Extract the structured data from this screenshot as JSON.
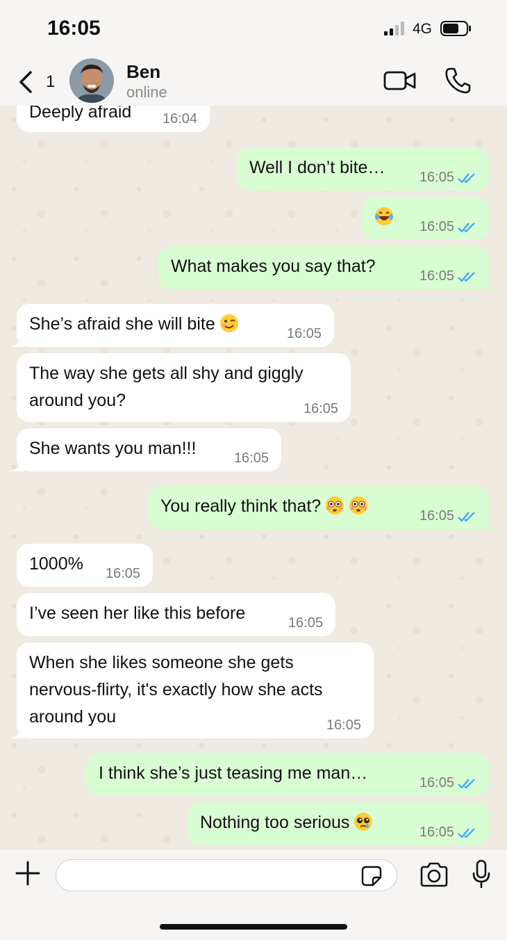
{
  "status_bar": {
    "time": "16:05",
    "network": "4G"
  },
  "header": {
    "back_count": "1",
    "contact_name": "Ben",
    "contact_status": "online"
  },
  "messages": [
    {
      "dir": "in",
      "text": "Deeply afraid",
      "time": "16:04"
    },
    {
      "dir": "out",
      "text": "Well I don’t bite…",
      "time": "16:05",
      "read": true
    },
    {
      "dir": "out",
      "text": "",
      "emoji": [
        "laughing-tears-emoji"
      ],
      "time": "16:05",
      "read": true
    },
    {
      "dir": "out",
      "text": "What makes you say that?",
      "time": "16:05",
      "read": true
    },
    {
      "dir": "in",
      "text": "She’s afraid she will bite",
      "emoji": [
        "winking-emoji"
      ],
      "time": "16:05"
    },
    {
      "dir": "in",
      "text": "The way she gets all shy and giggly around you?",
      "time": "16:05"
    },
    {
      "dir": "in",
      "text": "She wants you man!!!",
      "time": "16:05"
    },
    {
      "dir": "out",
      "text": "You really think that?",
      "emoji": [
        "flushed-emoji",
        "flushed-emoji"
      ],
      "time": "16:05",
      "read": true
    },
    {
      "dir": "in",
      "text": "1000%",
      "time": "16:05"
    },
    {
      "dir": "in",
      "text": "I’ve seen her like this before",
      "time": "16:05"
    },
    {
      "dir": "in",
      "text": "When she likes someone she gets nervous-flirty, it's exactly how she acts around you",
      "time": "16:05"
    },
    {
      "dir": "out",
      "text": "I think she’s just teasing me man…",
      "time": "16:05",
      "read": true
    },
    {
      "dir": "out",
      "text": "Nothing too serious",
      "emoji": [
        "pleading-emoji"
      ],
      "time": "16:05",
      "read": true
    }
  ],
  "composer": {
    "placeholder": ""
  },
  "colors": {
    "outgoing_bubble": "#d9fdd3",
    "incoming_bubble": "#ffffff",
    "read_tick": "#34a5f7",
    "chat_background": "#efeae2"
  }
}
